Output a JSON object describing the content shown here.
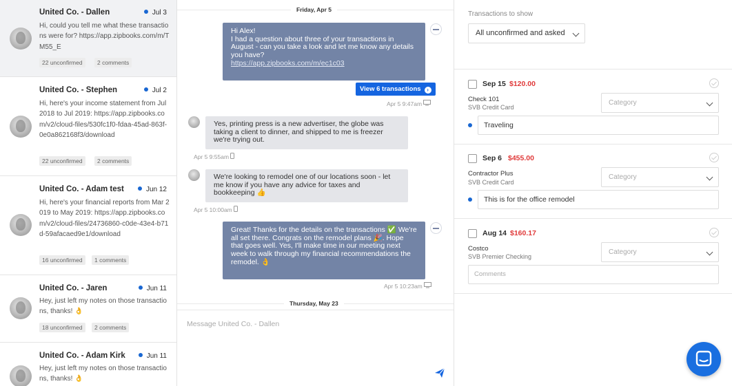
{
  "conversations": [
    {
      "name": "United Co. - Dallen",
      "date": "Jul 3",
      "preview": "Hi, could you tell me what these transactions were for? https://app.zipbooks.com/m/TM55_E",
      "unconfirmed": "22 unconfirmed",
      "comments": "2 comments"
    },
    {
      "name": "United Co. - Stephen",
      "date": "Jul 2",
      "preview": "Hi, here's your income statement from Jul 2018 to Jul 2019: https://app.zipbooks.com/v2/cloud-files/530fc1f0-fdaa-45ad-863f-0e0a862168f3/download",
      "unconfirmed": "22 unconfirmed",
      "comments": "2 comments"
    },
    {
      "name": "United Co. - Adam test",
      "date": "Jun 12",
      "preview": "Hi, here's your financial reports from Mar 2019 to May 2019: https://app.zipbooks.com/v2/cloud-files/24736860-c0de-43e4-b71d-59afacaed9e1/download",
      "unconfirmed": "16 unconfirmed",
      "comments": "1 comments"
    },
    {
      "name": "United Co. - Jaren",
      "date": "Jun 11",
      "preview": "Hey, just left my notes on those transactions, thanks! 👌",
      "unconfirmed": "18 unconfirmed",
      "comments": "2 comments"
    },
    {
      "name": "United Co. - Adam Kirk",
      "date": "Jun 11",
      "preview": "Hey, just left my notes on those transactions, thanks! 👌",
      "unconfirmed": "",
      "comments": ""
    }
  ],
  "chat": {
    "day1": "Friday, Apr 5",
    "msg1": {
      "line1": "Hi Alex!",
      "line2": "I had a question about three of your transactions in August - can you take a look and let me know any details you have?",
      "link": "https://app.zipbooks.com/m/ec1c03",
      "button": "View 6 transactions",
      "meta": "Apr 5 9:47am"
    },
    "msg2": {
      "text": "Yes, printing press is a new advertiser, the globe was taking a client to dinner, and shipped to me is freezer we're trying out.",
      "meta": "Apr 5 9:55am"
    },
    "msg3": {
      "text": "We're looking to remodel one of our locations soon - let me know if you have any advice for taxes and bookkeeping 👍",
      "meta": "Apr 5 10:00am"
    },
    "msg4": {
      "text": "Great! Thanks for the details on the transactions ✅ We're all set there. Congrats on the remodel plans 🎉. Hope that goes well. Yes, I'll make time in our meeting next week to walk through my financial recommendations the remodel. 👌",
      "meta": "Apr 5 10:23am"
    },
    "day2": "Thursday, May 23",
    "composer_placeholder": "Message United Co. - Dallen"
  },
  "transactions_panel": {
    "filter_label": "Transactions to show",
    "filter_value": "All unconfirmed and asked",
    "items": [
      {
        "date": "Sep 15",
        "amount": "$120.00",
        "description": "Check 101",
        "account": "SVB Credit Card",
        "category_placeholder": "Category",
        "note": "Traveling",
        "note_placeholder": ""
      },
      {
        "date": "Sep 6",
        "amount": "$455.00",
        "description": "Contractor Plus",
        "account": "SVB Credit Card",
        "category_placeholder": "Category",
        "note": "This is for the office remodel",
        "note_placeholder": ""
      },
      {
        "date": "Aug 14",
        "amount": "$160.17",
        "description": "Costco",
        "account": "SVB Premier Checking",
        "category_placeholder": "Category",
        "note": "",
        "note_placeholder": "Comments"
      }
    ]
  },
  "icons": {
    "send": "send-icon",
    "chat_launcher": "chat-bubble-icon",
    "device_desktop": "desktop-icon",
    "device_mobile": "mobile-icon"
  },
  "colors": {
    "accent": "#1565e0",
    "outgoing_bubble": "#7384a6",
    "incoming_bubble": "#e4e5e9",
    "amount_red": "#e03a3a"
  }
}
